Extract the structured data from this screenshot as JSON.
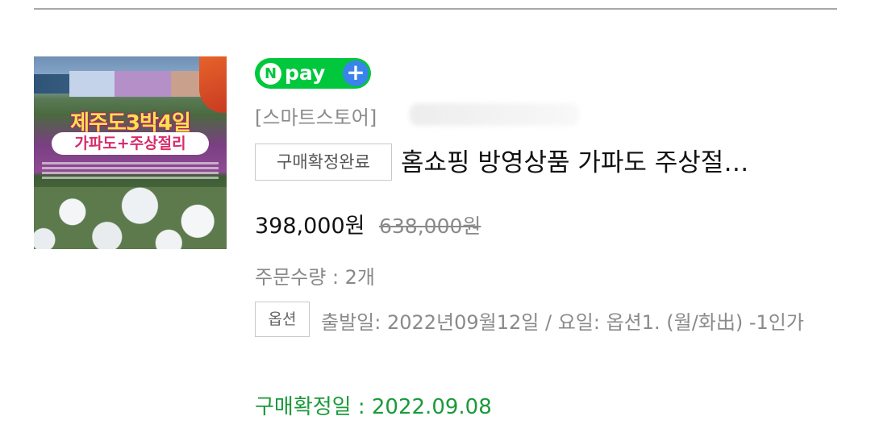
{
  "product": {
    "thumbnail": {
      "title_text": "제주도3박4일",
      "subtitle_text": "가파도+주상절리"
    },
    "npay_badge": {
      "n": "N",
      "pay": "pay",
      "plus": "+"
    },
    "store_label": "[스마트스토어]",
    "status_chip": "구매확정완료",
    "title": "홈쇼핑 방영상품 가파도 주상절…",
    "price": "398,000원",
    "original_price": "638,000원",
    "quantity": "주문수량 : 2개",
    "option_chip": "옵션",
    "option_text": "출발일: 2022년09월12일 / 요일: 옵션1. (월/화出) -1인가",
    "confirm_date": "구매확정일 : 2022.09.08"
  },
  "colors": {
    "npay_green": "#00c73c",
    "npay_plus_blue": "#3b83ec",
    "confirm_green": "#1a9a3a"
  }
}
